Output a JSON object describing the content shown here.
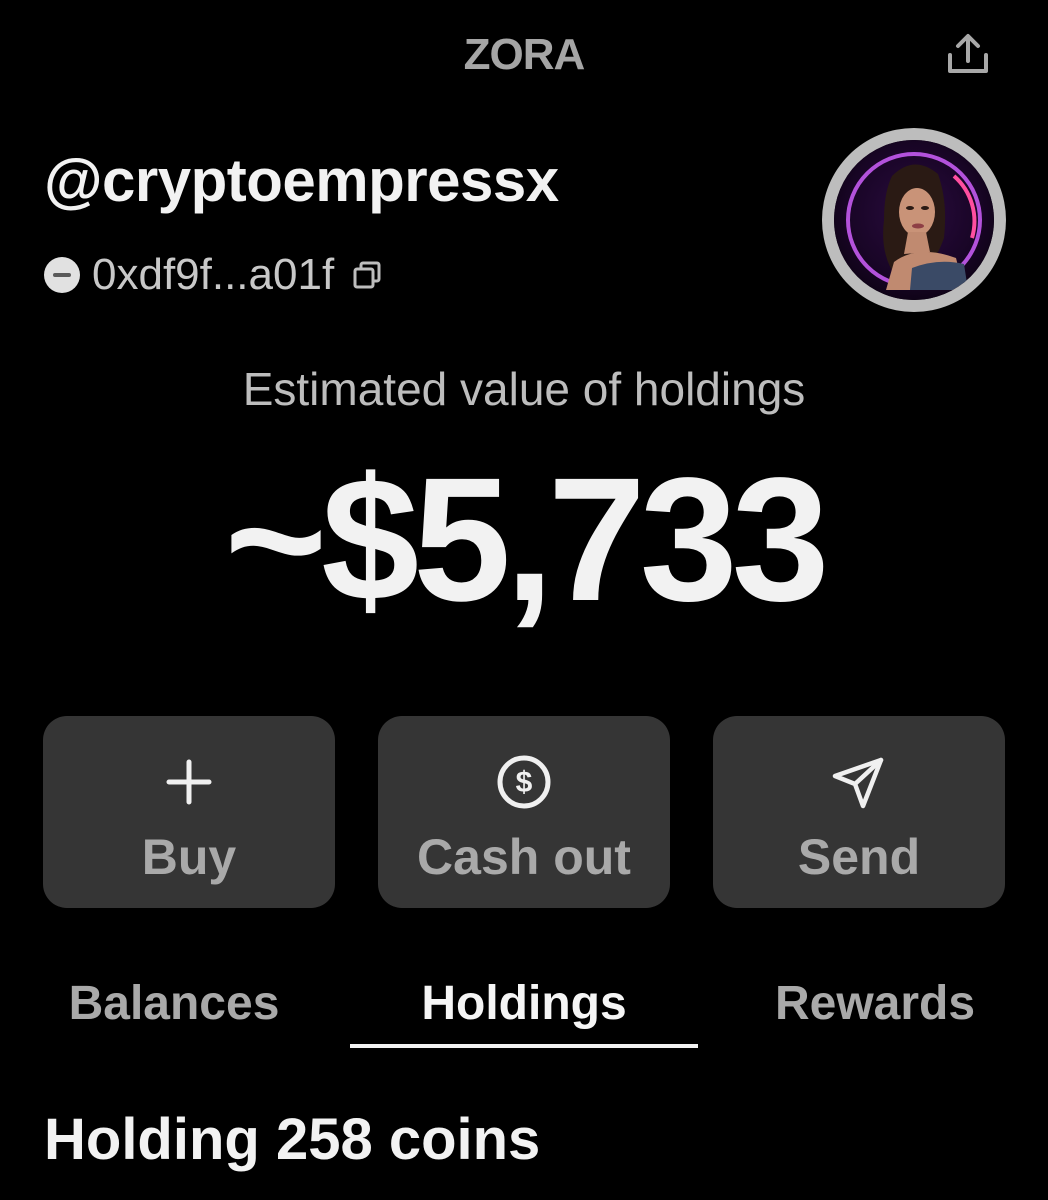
{
  "header": {
    "title": "ZORA",
    "share_icon": "share-icon"
  },
  "profile": {
    "username": "@cryptoempressx",
    "address": "0xdf9f...a01f",
    "copy_icon": "copy-icon",
    "avatar_icon": "avatar-photo"
  },
  "holdings": {
    "label": "Estimated value of holdings",
    "amount": "~$5,733"
  },
  "actions": [
    {
      "label": "Buy",
      "icon": "plus-icon"
    },
    {
      "label": "Cash out",
      "icon": "dollar-circle-icon"
    },
    {
      "label": "Send",
      "icon": "send-icon"
    }
  ],
  "tabs": [
    {
      "label": "Balances",
      "active": false
    },
    {
      "label": "Holdings",
      "active": true
    },
    {
      "label": "Rewards",
      "active": false
    }
  ],
  "holding_summary": "Holding 258 coins",
  "colors": {
    "background": "#000000",
    "button_bg": "#353535",
    "muted_text": "#a9a9a9",
    "accent_ring": "#b04bd6"
  }
}
